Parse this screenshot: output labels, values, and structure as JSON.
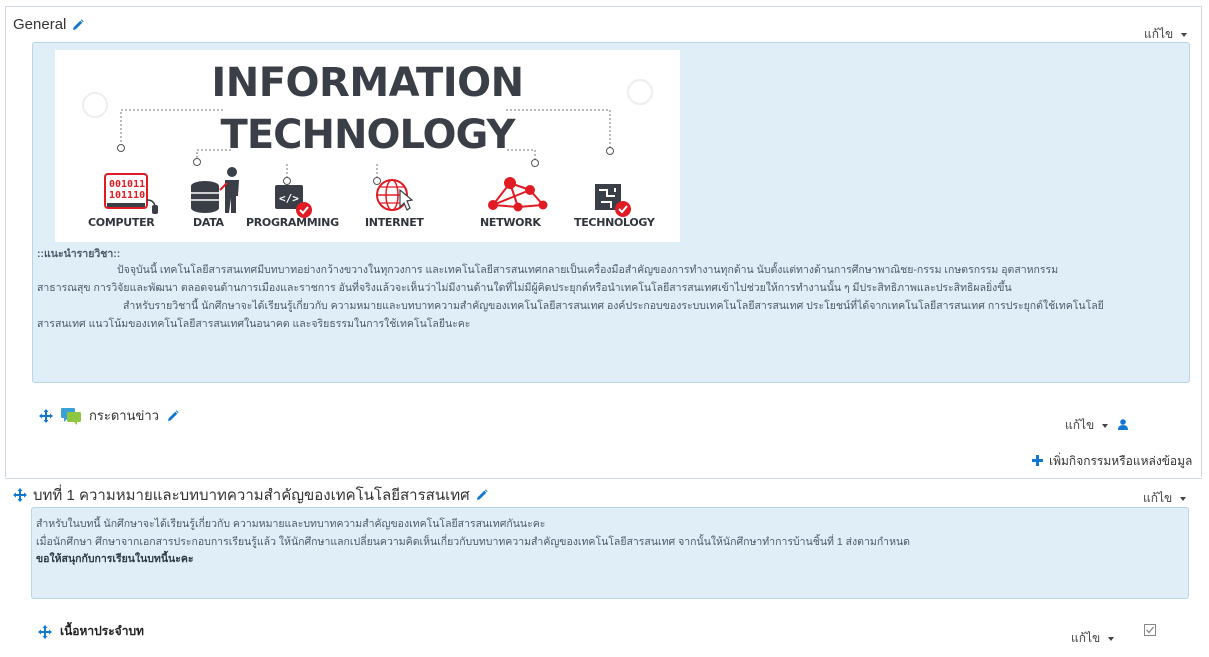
{
  "section_general": {
    "title": "General",
    "edit_label": "แก้ไข",
    "banner": {
      "line1": "INFORMATION",
      "line2": "TECHNOLOGY",
      "labels": [
        "COMPUTER",
        "DATA",
        "PROGRAMMING",
        "INTERNET",
        "NETWORK",
        "TECHNOLOGY"
      ],
      "computer_digits": [
        "001011",
        "101110"
      ]
    },
    "intro_heading": "::แนะนำรายวิชา::",
    "intro_p1a": "ปัจจุบันนี้ เทคโนโลยีสารสนเทศมีบทบาทอย่างกว้างขวางในทุกวงการ และเทคโนโลยีสารสนเทศกลายเป็นเครื่องมือสำคัญของการทำงานทุกด้าน นับตั้งแต่ทางด้านการศึกษาพาณิชย-กรรม เกษตรกรรม อุตสาหกรรม",
    "intro_p1b": "สาธารณสุข การวิจัยและพัฒนา ตลอดจนด้านการเมืองและราชการ อันที่จริงแล้วจะเห็นว่าไม่มีงานด้านใดที่ไม่มีผู้คิดประยุกต์หรือนำเทคโนโลยีสารสนเทศเข้าไปช่วยให้การทำงานนั้น ๆ มีประสิทธิภาพและประสิทธิผลยิ่งขึ้น",
    "intro_p2a": "สำหรับรายวิชานี้ นักศึกษาจะได้เรียนรู้เกี่ยวกับ ความหมายและบทบาทความสำคัญของเทคโนโลยีสารสนเทศ องค์ประกอบของระบบเทคโนโลยีสารสนเทศ ประโยชน์ที่ได้จากเทคโนโลยีสารสนเทศ การประยุกต์ใช้เทคโนโลยี",
    "intro_p2b": "สารสนเทศ แนวโน้มของเทคโนโลยีสารสนเทศในอนาคต และจริยธรรมในการใช้เทคโนโลยีนะคะ",
    "forum": {
      "name": "กระดานข่าว",
      "edit_label": "แก้ไข"
    },
    "add_activity_label": "เพิ่มกิจกรรมหรือแหล่งข้อมูล"
  },
  "section_1": {
    "title": "บทที่ 1 ความหมายและบทบาทความสำคัญของเทคโนโลยีสารสนเทศ",
    "edit_label": "แก้ไข",
    "summary_line1": "สำหรับในบทนี้ นักศึกษาจะได้เรียนรู้เกี่ยวกับ ความหมายและบทบาทความสำคัญของเทคโนโลยีสารสนเทศกันนะคะ",
    "summary_line2": "เมื่อนักศึกษา ศึกษาจากเอกสารประกอบการเรียนรู้แล้ว ให้นักศึกษาแลกเปลี่ยนความคิดเห็นเกี่ยวกับบทบาทความสำคัญของเทคโนโลยีสารสนเทศ จากนั้นให้นักศึกษาทำการบ้านชิ้นที่ 1 ส่งตามกำหนด",
    "summary_line3": "ขอให้สนุกกับการเรียนในบทนี้นะคะ",
    "content_item": {
      "name": "เนื้อหาประจำบท",
      "edit_label": "แก้ไข"
    }
  },
  "colors": {
    "accent": "#1177d1",
    "summary_bg": "#dfeef7",
    "summary_border": "#b9d5e6",
    "red": "#e11b24"
  }
}
